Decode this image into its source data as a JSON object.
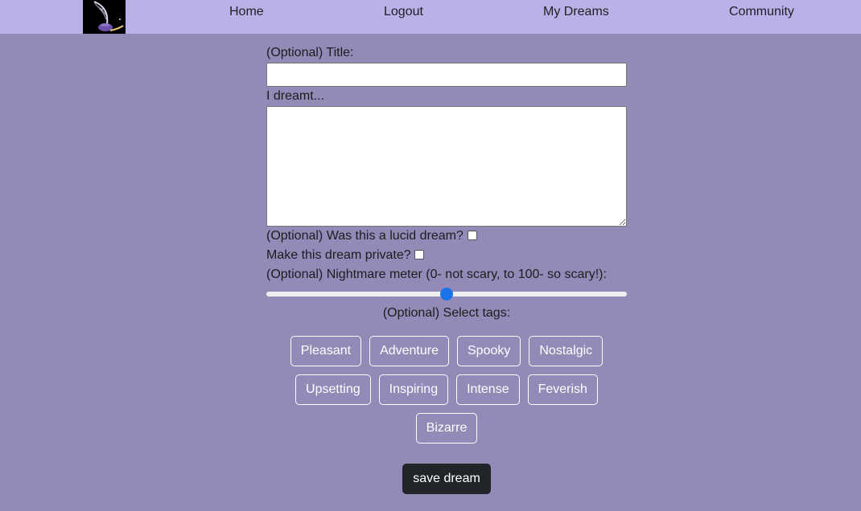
{
  "nav": {
    "logo_icon": "quill-inkwell-logo-icon",
    "links": [
      "Home",
      "Logout",
      "My Dreams",
      "Community"
    ]
  },
  "form": {
    "title_label": "(Optional) Title:",
    "title_value": "",
    "dream_label": "I dreamt...",
    "dream_value": "",
    "lucid_label": "(Optional) Was this a lucid dream?",
    "lucid_checked": false,
    "private_label": "Make this dream private?",
    "private_checked": false,
    "nightmare_label": "(Optional) Nightmare meter (0- not scary, to 100- so scary!):",
    "nightmare_min": 0,
    "nightmare_max": 100,
    "nightmare_value": 50,
    "tags_label": "(Optional) Select tags:",
    "tag_rows": [
      [
        "Pleasant",
        "Adventure",
        "Spooky",
        "Nostalgic"
      ],
      [
        "Upsetting",
        "Inspiring",
        "Intense",
        "Feverish"
      ],
      [
        "Bizarre"
      ]
    ],
    "save_label": "save dream"
  },
  "colors": {
    "page_background": "#948ab8",
    "navbar_background": "#bbb0e8",
    "slider_thumb": "#1a73e8",
    "save_button": "#212529"
  }
}
